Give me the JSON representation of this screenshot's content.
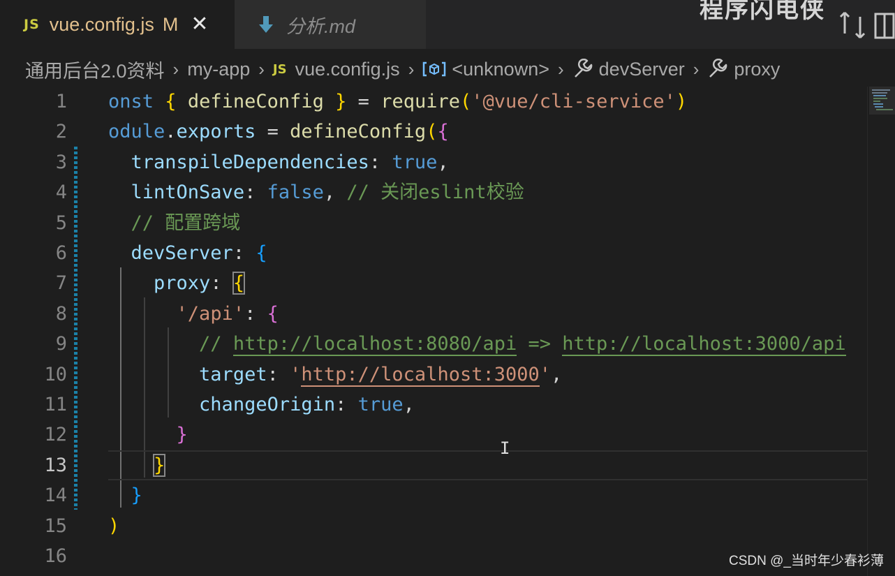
{
  "tabs": [
    {
      "icon": "js-file-icon",
      "badge": "JS",
      "name": "vue.config.js",
      "status": "M",
      "close": "✕",
      "active": true
    },
    {
      "icon": "markdown-file-icon",
      "name": "分析.md",
      "active": false
    }
  ],
  "overlay_text": "程序闪电侠",
  "breadcrumb": {
    "items": [
      {
        "label": "通用后台2.0资料"
      },
      {
        "label": "my-app"
      },
      {
        "label": "vue.config.js",
        "icon": "JS"
      },
      {
        "label": "<unknown>",
        "icon": "[⊘]"
      },
      {
        "label": "devServer",
        "icon": "wrench"
      },
      {
        "label": "proxy",
        "icon": "wrench"
      }
    ],
    "separator": "›"
  },
  "editor": {
    "current_line": 13,
    "lines": [
      {
        "n": "1",
        "tokens": [
          [
            "kw",
            "onst "
          ],
          [
            "b1",
            "{"
          ],
          [
            "pn",
            " "
          ],
          [
            "fn",
            "defineConfig"
          ],
          [
            "pn",
            " "
          ],
          [
            "b1",
            "}"
          ],
          [
            "pn",
            " = "
          ],
          [
            "fn",
            "require"
          ],
          [
            "b1",
            "("
          ],
          [
            "st",
            "'@vue/cli-service'"
          ],
          [
            "b1",
            ")"
          ]
        ]
      },
      {
        "n": "2",
        "tokens": [
          [
            "kw",
            "odule"
          ],
          [
            "pn",
            "."
          ],
          [
            "pr",
            "exports"
          ],
          [
            "pn",
            " = "
          ],
          [
            "fn",
            "defineConfig"
          ],
          [
            "b1",
            "("
          ],
          [
            "b2",
            "{"
          ]
        ]
      },
      {
        "n": "3",
        "tokens": [
          [
            "pn",
            "  "
          ],
          [
            "pr",
            "transpileDependencies"
          ],
          [
            "pn",
            ": "
          ],
          [
            "kw",
            "true"
          ],
          [
            "pn",
            ","
          ]
        ]
      },
      {
        "n": "4",
        "tokens": [
          [
            "pn",
            "  "
          ],
          [
            "pr",
            "lintOnSave"
          ],
          [
            "pn",
            ": "
          ],
          [
            "kw",
            "false"
          ],
          [
            "pn",
            ", "
          ],
          [
            "cm",
            "// 关闭eslint校验"
          ]
        ]
      },
      {
        "n": "5",
        "tokens": [
          [
            "pn",
            "  "
          ],
          [
            "cm",
            "// 配置跨域"
          ]
        ]
      },
      {
        "n": "6",
        "tokens": [
          [
            "pn",
            "  "
          ],
          [
            "pr",
            "devServer"
          ],
          [
            "pn",
            ": "
          ],
          [
            "b3",
            "{"
          ]
        ]
      },
      {
        "n": "7",
        "tokens": [
          [
            "pn",
            "    "
          ],
          [
            "pr",
            "proxy"
          ],
          [
            "pn",
            ": "
          ],
          [
            "b1m",
            "{"
          ]
        ]
      },
      {
        "n": "8",
        "tokens": [
          [
            "pn",
            "      "
          ],
          [
            "st",
            "'/api'"
          ],
          [
            "pn",
            ": "
          ],
          [
            "b2",
            "{"
          ]
        ]
      },
      {
        "n": "9",
        "tokens": [
          [
            "pn",
            "        "
          ],
          [
            "cm",
            "// "
          ],
          [
            "url-cm",
            "http://localhost:8080/api"
          ],
          [
            "cm",
            " => "
          ],
          [
            "url-cm",
            "http://localhost:3000/api"
          ]
        ]
      },
      {
        "n": "10",
        "tokens": [
          [
            "pn",
            "        "
          ],
          [
            "pr",
            "target"
          ],
          [
            "pn",
            ": "
          ],
          [
            "st",
            "'"
          ],
          [
            "url-st",
            "http://localhost:3000"
          ],
          [
            "st",
            "'"
          ],
          [
            "pn",
            ","
          ]
        ]
      },
      {
        "n": "11",
        "tokens": [
          [
            "pn",
            "        "
          ],
          [
            "pr",
            "changeOrigin"
          ],
          [
            "pn",
            ": "
          ],
          [
            "kw",
            "true"
          ],
          [
            "pn",
            ","
          ]
        ]
      },
      {
        "n": "12",
        "tokens": [
          [
            "pn",
            "      "
          ],
          [
            "b2",
            "}"
          ]
        ]
      },
      {
        "n": "13",
        "tokens": [
          [
            "pn",
            "    "
          ],
          [
            "b1m",
            "}"
          ]
        ]
      },
      {
        "n": "14",
        "tokens": [
          [
            "pn",
            "  "
          ],
          [
            "b3",
            "}"
          ]
        ]
      },
      {
        "n": "15",
        "tokens": [
          [
            "b1",
            ")"
          ]
        ]
      },
      {
        "n": "16",
        "tokens": []
      }
    ]
  },
  "watermark": "CSDN @_当时年少春衫薄",
  "colors": {
    "editor_bg": "#1e1e1e",
    "keyword": "#569cd6",
    "property": "#9cdcfe",
    "function": "#dcdcaa",
    "string": "#ce9178",
    "comment": "#6a9955",
    "bracket_gold": "#ffd700",
    "bracket_orchid": "#da70d6",
    "bracket_blue": "#179fff",
    "modified": "#e2c08d",
    "js_badge": "#cbcb41"
  }
}
